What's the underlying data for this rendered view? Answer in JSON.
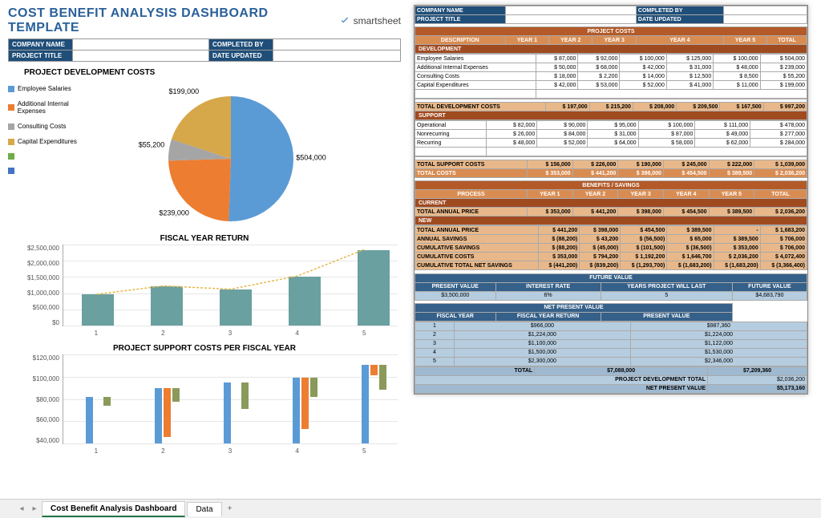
{
  "title": "COST BENEFIT ANALYSIS DASHBOARD TEMPLATE",
  "logo": "smartsheet",
  "header_left": {
    "company": "COMPANY NAME",
    "project": "PROJECT TITLE",
    "completed": "COMPLETED BY",
    "updated": "DATE UPDATED"
  },
  "sections": {
    "pie_title": "PROJECT DEVELOPMENT COSTS",
    "bar1_title": "FISCAL YEAR RETURN",
    "bar2_title": "PROJECT SUPPORT COSTS PER FISCAL YEAR"
  },
  "legend_items": [
    {
      "label": "Employee Salaries",
      "color": "#5b9bd5"
    },
    {
      "label": "Additional Internal Expenses",
      "color": "#ed7d31"
    },
    {
      "label": "Consulting Costs",
      "color": "#a5a5a5"
    },
    {
      "label": "Capital Expenditures",
      "color": "#d6a84a"
    },
    {
      "label": "",
      "color": "#70ad47"
    },
    {
      "label": "",
      "color": "#4472c4"
    }
  ],
  "chart_data": [
    {
      "type": "pie",
      "title": "PROJECT DEVELOPMENT COSTS",
      "series": [
        {
          "name": "Employee Salaries",
          "value": 504000,
          "label": "$504,000",
          "color": "#5b9bd5"
        },
        {
          "name": "Additional Internal Expenses",
          "value": 239000,
          "label": "$239,000",
          "color": "#ed7d31"
        },
        {
          "name": "Consulting Costs",
          "value": 55200,
          "label": "$55,200",
          "color": "#a5a5a5"
        },
        {
          "name": "Capital Expenditures",
          "value": 199000,
          "label": "$199,000",
          "color": "#d6a84a"
        }
      ]
    },
    {
      "type": "bar",
      "title": "FISCAL YEAR RETURN",
      "categories": [
        "1",
        "2",
        "3",
        "4",
        "5"
      ],
      "values": [
        966000,
        1224000,
        1122000,
        1530000,
        2346000
      ],
      "ylim": [
        0,
        2500000
      ],
      "y_ticks": [
        "$2,500,000",
        "$2,000,000",
        "$1,500,000",
        "$1,000,000",
        "$500,000",
        "$0"
      ],
      "line_overlay": true
    },
    {
      "type": "bar",
      "title": "PROJECT SUPPORT COSTS PER FISCAL YEAR",
      "categories": [
        "1",
        "2",
        "3",
        "4",
        "5"
      ],
      "series": [
        {
          "name": "Operational",
          "color": "#5b9bd5",
          "values": [
            82000,
            90000,
            95000,
            100000,
            111000
          ]
        },
        {
          "name": "Nonrecurring",
          "color": "#ed7d31",
          "values": [
            26000,
            84000,
            31000,
            87000,
            49000
          ]
        },
        {
          "name": "Recurring",
          "color": "#8a9a5b",
          "values": [
            48000,
            52000,
            64000,
            58000,
            62000
          ]
        }
      ],
      "ylim": [
        40000,
        120000
      ],
      "y_ticks": [
        "$120,000",
        "$100,000",
        "$80,000",
        "$60,000",
        "$40,000"
      ]
    }
  ],
  "sheet": {
    "header": {
      "company": "COMPANY NAME",
      "project": "PROJECT TITLE",
      "completed": "COMPLETED BY",
      "updated": "DATE UPDATED"
    },
    "proj_costs_title": "PROJECT COSTS",
    "cols": [
      "DESCRIPTION",
      "YEAR 1",
      "YEAR 2",
      "YEAR 3",
      "YEAR 4",
      "YEAR 5",
      "TOTAL"
    ],
    "dev_label": "DEVELOPMENT",
    "dev_rows": [
      {
        "d": "Employee Salaries",
        "v": [
          "87,000",
          "92,000",
          "100,000",
          "125,000",
          "100,000",
          "504,000"
        ]
      },
      {
        "d": "Additional Internal Expenses",
        "v": [
          "50,000",
          "68,000",
          "42,000",
          "31,000",
          "48,000",
          "239,000"
        ]
      },
      {
        "d": "Consulting Costs",
        "v": [
          "18,000",
          "2,200",
          "14,000",
          "12,500",
          "8,500",
          "55,200"
        ]
      },
      {
        "d": "Capital Expenditures",
        "v": [
          "42,000",
          "53,000",
          "52,000",
          "41,000",
          "11,000",
          "199,000"
        ]
      }
    ],
    "dev_total": {
      "d": "TOTAL DEVELOPMENT COSTS",
      "v": [
        "197,000",
        "215,200",
        "208,000",
        "209,500",
        "167,500",
        "997,200"
      ]
    },
    "sup_label": "SUPPORT",
    "sup_rows": [
      {
        "d": "Operational",
        "v": [
          "82,000",
          "90,000",
          "95,000",
          "100,000",
          "111,000",
          "478,000"
        ]
      },
      {
        "d": "Nonrecurring",
        "v": [
          "26,000",
          "84,000",
          "31,000",
          "87,000",
          "49,000",
          "277,000"
        ]
      },
      {
        "d": "Recurring",
        "v": [
          "48,000",
          "52,000",
          "64,000",
          "58,000",
          "62,000",
          "284,000"
        ]
      }
    ],
    "sup_total": {
      "d": "TOTAL SUPPORT COSTS",
      "v": [
        "156,000",
        "226,000",
        "190,000",
        "245,000",
        "222,000",
        "1,039,000"
      ]
    },
    "cost_total": {
      "d": "TOTAL COSTS",
      "v": [
        "353,000",
        "441,200",
        "398,000",
        "454,500",
        "389,500",
        "2,036,200"
      ]
    },
    "benefits_title": "BENEFITS / SAVINGS",
    "ben_cols": [
      "PROCESS",
      "YEAR 1",
      "YEAR 2",
      "YEAR 3",
      "YEAR 4",
      "YEAR 5",
      "TOTAL"
    ],
    "current_label": "CURRENT",
    "current_row": {
      "d": "TOTAL ANNUAL PRICE",
      "v": [
        "353,000",
        "441,200",
        "398,000",
        "454,500",
        "389,500",
        "2,036,200"
      ]
    },
    "new_label": "NEW",
    "new_rows": [
      {
        "d": "TOTAL ANNUAL PRICE",
        "v": [
          "441,200",
          "398,000",
          "454,500",
          "389,500",
          "",
          "1,683,200"
        ]
      },
      {
        "d": "ANNUAL SAVINGS",
        "v": [
          "(88,200)",
          "43,200",
          "(56,500)",
          "65,000",
          "389,500",
          "706,000"
        ]
      },
      {
        "d": "CUMULATIVE SAVINGS",
        "v": [
          "(88,200)",
          "(45,000)",
          "(101,500)",
          "(36,500)",
          "353,000",
          "706,000"
        ]
      },
      {
        "d": "CUMULATIVE COSTS",
        "v": [
          "353,000",
          "794,200",
          "1,192,200",
          "1,646,700",
          "2,036,200",
          "4,072,400"
        ]
      },
      {
        "d": "CUMULATIVE TOTAL NET SAVINGS",
        "v": [
          "(441,200)",
          "(839,200)",
          "(1,293,700)",
          "(1,683,200)",
          "(1,683,200)",
          "(3,366,400)"
        ]
      }
    ],
    "fv_title": "FUTURE VALUE",
    "fv_cols": [
      "PRESENT VALUE",
      "INTEREST RATE",
      "YEARS PROJECT WILL LAST",
      "FUTURE VALUE"
    ],
    "fv_row": [
      "$3,500,000",
      "6%",
      "5",
      "$4,683,790"
    ],
    "npv_title": "NET PRESENT VALUE",
    "npv_cols": [
      "FISCAL YEAR",
      "FISCAL YEAR RETURN",
      "PRESENT VALUE"
    ],
    "npv_rows": [
      {
        "v": [
          "1",
          "$966,000",
          "$987,360"
        ]
      },
      {
        "v": [
          "2",
          "$1,224,000",
          "$1,224,000"
        ]
      },
      {
        "v": [
          "3",
          "$1,100,000",
          "$1,122,000"
        ]
      },
      {
        "v": [
          "4",
          "$1,500,000",
          "$1,530,000"
        ]
      },
      {
        "v": [
          "5",
          "$2,300,000",
          "$2,346,000"
        ]
      }
    ],
    "npv_total": {
      "l": "TOTAL",
      "v": [
        "$7,088,000",
        "$7,209,360"
      ]
    },
    "npv_devtot": {
      "l": "PROJECT DEVELOPMENT TOTAL",
      "v": "$2,036,200"
    },
    "npv_net": {
      "l": "NET PRESENT VALUE",
      "v": "$5,173,160"
    }
  },
  "tabs": {
    "t1": "Cost Benefit Analysis Dashboard",
    "t2": "Data"
  }
}
